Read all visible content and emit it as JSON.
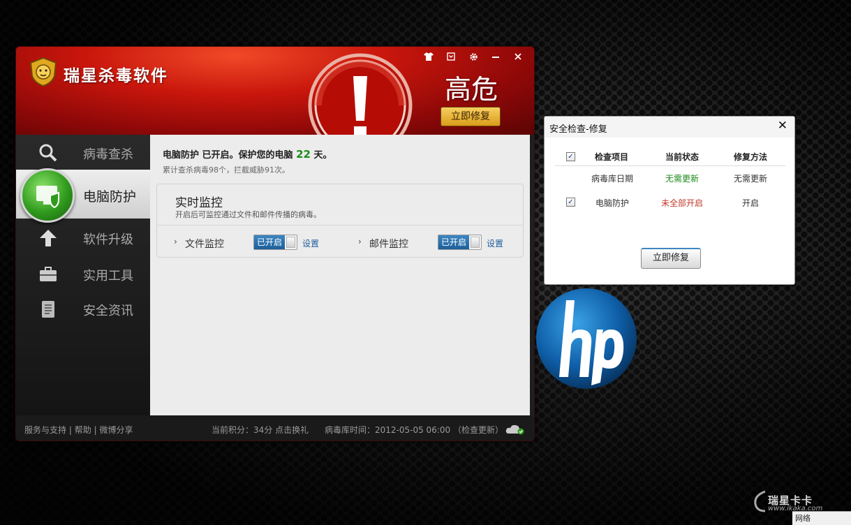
{
  "app": {
    "title": "瑞星杀毒软件"
  },
  "header": {
    "threat_level": "高危",
    "fix_now_label": "立即修复"
  },
  "sidebar": {
    "items": [
      {
        "label": "病毒查杀",
        "icon": "search-icon"
      },
      {
        "label": "电脑防护",
        "icon": "shield-monitor-icon",
        "active": true
      },
      {
        "label": "软件升级",
        "icon": "arrow-up-icon"
      },
      {
        "label": "实用工具",
        "icon": "toolbox-icon"
      },
      {
        "label": "安全资讯",
        "icon": "document-icon"
      }
    ]
  },
  "content": {
    "protection_prefix": "电脑防护 已开启。保护您的电脑 ",
    "protection_days": "22",
    "protection_suffix": " 天。",
    "stats": "累计查杀病毒98个，拦截威胁91次。",
    "monitor": {
      "title": "实时监控",
      "desc": "开启后可监控通过文件和邮件传播的病毒。",
      "items": [
        {
          "label": "文件监控",
          "toggle": "已开启",
          "settings": "设置"
        },
        {
          "label": "邮件监控",
          "toggle": "已开启",
          "settings": "设置"
        }
      ]
    }
  },
  "footer": {
    "support": "服务与支持",
    "sep": "|",
    "help": "帮助",
    "share": "微博分享",
    "points": "当前积分：34分",
    "redeem": "点击换礼",
    "db_time": "病毒库时间：2012-05-05 06:00",
    "check_update": "（检查更新）"
  },
  "dialog": {
    "title": "安全检查-修复",
    "columns": [
      "检查项目",
      "当前状态",
      "修复方法"
    ],
    "rows": [
      {
        "item": "病毒库日期",
        "status": "无需更新",
        "method": "无需更新",
        "checkbox": false
      },
      {
        "item": "电脑防护",
        "status": "未全部开启",
        "method": "开启",
        "checkbox": true
      }
    ],
    "fix_label": "立即修复",
    "checkmark": "✓",
    "close_glyph": "✕"
  },
  "watermark": {
    "brand": "瑞星卡卡",
    "url": "www.ikaka.com"
  },
  "tray": {
    "label": "网络"
  },
  "colors": {
    "header_red": "#c9160c",
    "accent_blue": "#1d5f9a",
    "ok_green": "#1d8a1d",
    "warn_red": "#c0392b",
    "gold": "#d99d19"
  }
}
